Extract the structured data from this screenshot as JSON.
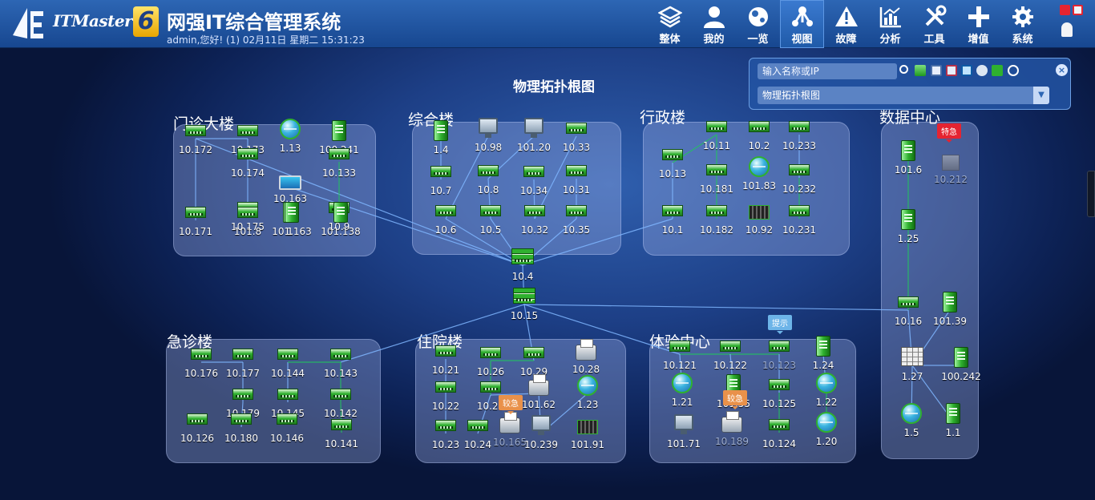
{
  "app": {
    "brand": "ITMaster",
    "version": "6",
    "title": "网强IT综合管理系统",
    "user_status": "admin,您好! (1) 02月11日 星期二 15:31:23"
  },
  "menu": [
    {
      "id": "overall",
      "label": "整体",
      "icon": "layers-icon"
    },
    {
      "id": "mine",
      "label": "我的",
      "icon": "user-icon"
    },
    {
      "id": "overview",
      "label": "一览",
      "icon": "globe-icon"
    },
    {
      "id": "view",
      "label": "视图",
      "icon": "topology-icon",
      "active": true
    },
    {
      "id": "fault",
      "label": "故障",
      "icon": "warning-icon"
    },
    {
      "id": "analysis",
      "label": "分析",
      "icon": "chart-icon"
    },
    {
      "id": "tools",
      "label": "工具",
      "icon": "tools-icon"
    },
    {
      "id": "addon",
      "label": "增值",
      "icon": "plus-icon"
    },
    {
      "id": "system",
      "label": "系统",
      "icon": "gear-icon"
    }
  ],
  "search": {
    "placeholder": "输入名称或IP",
    "view_value": "物理拓扑根图"
  },
  "topology": {
    "title": "物理拓扑根图",
    "groups": [
      {
        "id": "mz",
        "name": "门诊大楼"
      },
      {
        "id": "zh",
        "name": "综合楼"
      },
      {
        "id": "xz",
        "name": "行政楼"
      },
      {
        "id": "sj",
        "name": "数据中心"
      },
      {
        "id": "jz",
        "name": "急诊楼"
      },
      {
        "id": "zy",
        "name": "住院楼"
      },
      {
        "id": "ty",
        "name": "体验中心"
      }
    ],
    "nodes": [
      {
        "id": "n10172",
        "label": "10.172",
        "type": "switch"
      },
      {
        "id": "n10173",
        "label": "10.173",
        "type": "switch"
      },
      {
        "id": "n113",
        "label": "1.13",
        "type": "globe"
      },
      {
        "id": "n100241",
        "label": "100.241",
        "type": "server"
      },
      {
        "id": "n10174",
        "label": "10.174",
        "type": "switch"
      },
      {
        "id": "n10163",
        "label": "10.163",
        "type": "laptop"
      },
      {
        "id": "n10133",
        "label": "10.133",
        "type": "switch"
      },
      {
        "id": "n10175",
        "label": "10.175",
        "type": "switch"
      },
      {
        "id": "n1",
        "label": "1",
        "type": "server"
      },
      {
        "id": "n109",
        "label": "10.9",
        "type": "switch"
      },
      {
        "id": "n10171",
        "label": "10.171",
        "type": "switch"
      },
      {
        "id": "n1018",
        "label": "101.8",
        "type": "switch"
      },
      {
        "id": "n101163",
        "label": "101.163",
        "type": "server"
      },
      {
        "id": "n101138",
        "label": "101.138",
        "type": "server"
      },
      {
        "id": "n14",
        "label": "1.4",
        "type": "server"
      },
      {
        "id": "n1098",
        "label": "10.98",
        "type": "pc"
      },
      {
        "id": "n10120",
        "label": "101.20",
        "type": "pc"
      },
      {
        "id": "n1033",
        "label": "10.33",
        "type": "switch"
      },
      {
        "id": "n107",
        "label": "10.7",
        "type": "switch"
      },
      {
        "id": "n108",
        "label": "10.8",
        "type": "switch"
      },
      {
        "id": "n1034",
        "label": "10.34",
        "type": "switch"
      },
      {
        "id": "n1031",
        "label": "10.31",
        "type": "switch"
      },
      {
        "id": "n106",
        "label": "10.6",
        "type": "switch"
      },
      {
        "id": "n105",
        "label": "10.5",
        "type": "switch"
      },
      {
        "id": "n1032",
        "label": "10.32",
        "type": "switch"
      },
      {
        "id": "n1035",
        "label": "10.35",
        "type": "switch"
      },
      {
        "id": "n1011",
        "label": "10.11",
        "type": "switch"
      },
      {
        "id": "n102",
        "label": "10.2",
        "type": "switch"
      },
      {
        "id": "n10233",
        "label": "10.233",
        "type": "switch"
      },
      {
        "id": "n1013",
        "label": "10.13",
        "type": "switch"
      },
      {
        "id": "n10181",
        "label": "10.181",
        "type": "switch"
      },
      {
        "id": "n10183",
        "label": "101.83",
        "type": "globe"
      },
      {
        "id": "n10232",
        "label": "10.232",
        "type": "switch"
      },
      {
        "id": "n101",
        "label": "10.1",
        "type": "switch"
      },
      {
        "id": "n10182",
        "label": "10.182",
        "type": "switch"
      },
      {
        "id": "n1092",
        "label": "10.92",
        "type": "rack"
      },
      {
        "id": "n10231",
        "label": "10.231",
        "type": "switch"
      },
      {
        "id": "n1016",
        "label": "101.6",
        "type": "server"
      },
      {
        "id": "n10212",
        "label": "10.212",
        "type": "grey",
        "dim": true
      },
      {
        "id": "n125",
        "label": "1.25",
        "type": "server"
      },
      {
        "id": "n1016b",
        "label": "10.16",
        "type": "switch"
      },
      {
        "id": "n10139",
        "label": "101.39",
        "type": "server"
      },
      {
        "id": "n127",
        "label": "1.27",
        "type": "firewall"
      },
      {
        "id": "n100242",
        "label": "100.242",
        "type": "server"
      },
      {
        "id": "n15",
        "label": "1.5",
        "type": "globe"
      },
      {
        "id": "n11",
        "label": "1.1",
        "type": "server"
      },
      {
        "id": "n104",
        "label": "10.4",
        "type": "core"
      },
      {
        "id": "n1015",
        "label": "10.15",
        "type": "core"
      },
      {
        "id": "n10176",
        "label": "10.176",
        "type": "switch"
      },
      {
        "id": "n10177",
        "label": "10.177",
        "type": "switch"
      },
      {
        "id": "n10144",
        "label": "10.144",
        "type": "switch"
      },
      {
        "id": "n10143",
        "label": "10.143",
        "type": "switch"
      },
      {
        "id": "n10179",
        "label": "10.179",
        "type": "switch"
      },
      {
        "id": "n10145",
        "label": "10.145",
        "type": "switch"
      },
      {
        "id": "n10142",
        "label": "10.142",
        "type": "switch"
      },
      {
        "id": "n10126",
        "label": "10.126",
        "type": "switch"
      },
      {
        "id": "n10180",
        "label": "10.180",
        "type": "switch"
      },
      {
        "id": "n10146",
        "label": "10.146",
        "type": "switch"
      },
      {
        "id": "n10141",
        "label": "10.141",
        "type": "switch"
      },
      {
        "id": "n1021",
        "label": "10.21",
        "type": "switch"
      },
      {
        "id": "n1026",
        "label": "10.26",
        "type": "switch"
      },
      {
        "id": "n1029",
        "label": "10.29",
        "type": "switch"
      },
      {
        "id": "n1028",
        "label": "10.28",
        "type": "printer"
      },
      {
        "id": "n1022",
        "label": "10.22",
        "type": "switch"
      },
      {
        "id": "n1025",
        "label": "10.25",
        "type": "switch"
      },
      {
        "id": "n10162",
        "label": "101.62",
        "type": "printer"
      },
      {
        "id": "n123",
        "label": "1.23",
        "type": "globe"
      },
      {
        "id": "n1023",
        "label": "10.23",
        "type": "switch"
      },
      {
        "id": "n1024",
        "label": "10.24",
        "type": "switch"
      },
      {
        "id": "n10165",
        "label": "10.165",
        "type": "printer",
        "dim": true
      },
      {
        "id": "n10239",
        "label": "10.239",
        "type": "pc"
      },
      {
        "id": "n10191",
        "label": "101.91",
        "type": "rack"
      },
      {
        "id": "n10121",
        "label": "10.121",
        "type": "switch"
      },
      {
        "id": "n10122",
        "label": "10.122",
        "type": "switch"
      },
      {
        "id": "n10123",
        "label": "10.123",
        "type": "switch",
        "dim": true
      },
      {
        "id": "n124",
        "label": "1.24",
        "type": "server"
      },
      {
        "id": "n121",
        "label": "1.21",
        "type": "globe"
      },
      {
        "id": "n10155",
        "label": "101.55",
        "type": "server"
      },
      {
        "id": "n10125",
        "label": "10.125",
        "type": "switch"
      },
      {
        "id": "n122",
        "label": "1.22",
        "type": "globe"
      },
      {
        "id": "n10171b",
        "label": "101.71",
        "type": "pc"
      },
      {
        "id": "n10189",
        "label": "10.189",
        "type": "printer",
        "dim": true
      },
      {
        "id": "n10124",
        "label": "10.124",
        "type": "switch"
      },
      {
        "id": "n120",
        "label": "1.20",
        "type": "globe"
      }
    ],
    "badges": [
      {
        "id": "b1",
        "text": "特急",
        "tone": "red"
      },
      {
        "id": "b2",
        "text": "较急",
        "tone": "orange"
      },
      {
        "id": "b3",
        "text": "较急",
        "tone": "orange"
      },
      {
        "id": "b4",
        "text": "提示",
        "tone": "blue"
      }
    ]
  },
  "colors": {
    "link": "#7fb6ff",
    "accent_link": "#22c55e",
    "panel": "#2355a5",
    "badge_red": "#e52431"
  }
}
